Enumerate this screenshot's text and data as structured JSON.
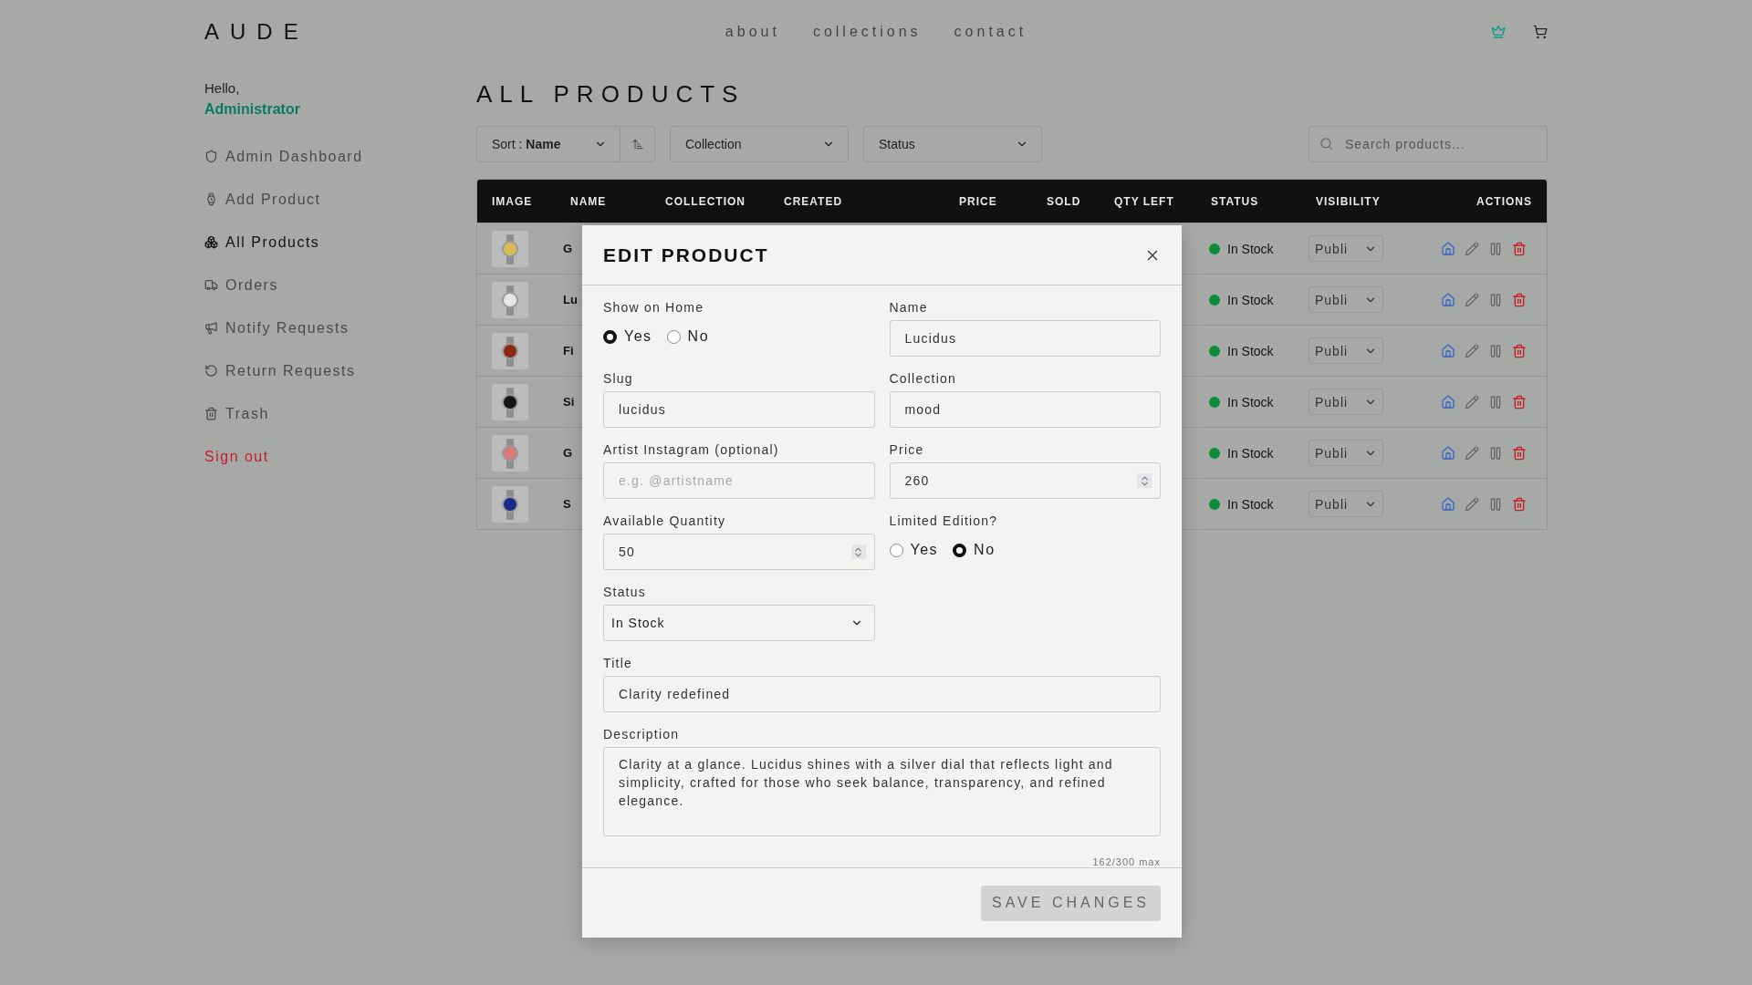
{
  "header": {
    "logo": "AUDE",
    "nav": [
      {
        "label": "about"
      },
      {
        "label": "collections"
      },
      {
        "label": "contact"
      }
    ]
  },
  "sidebar": {
    "greeting": "Hello,",
    "user": "Administrator",
    "items": [
      {
        "label": "Admin Dashboard",
        "selected": false
      },
      {
        "label": "Add Product",
        "selected": false
      },
      {
        "label": "All Products",
        "selected": true
      },
      {
        "label": "Orders",
        "selected": false
      },
      {
        "label": "Notify Requests",
        "selected": false
      },
      {
        "label": "Return Requests",
        "selected": false
      },
      {
        "label": "Trash",
        "selected": false
      }
    ],
    "sign_out": "Sign out"
  },
  "page_title": "ALL PRODUCTS",
  "toolbar": {
    "sort_label": "Sort :",
    "sort_value": "Name",
    "collection": "Collection",
    "status": "Status",
    "search": {
      "placeholder": "Search products..."
    }
  },
  "table": {
    "columns": [
      "IMAGE",
      "NAME",
      "COLLECTION",
      "CREATED",
      "PRICE",
      "SOLD",
      "QTY LEFT",
      "STATUS",
      "VISIBILITY",
      "ACTIONS"
    ],
    "rows": [
      {
        "name": "G",
        "status": "In Stock",
        "color": "#0f8a3a",
        "visibility": "Publi"
      },
      {
        "name": "Lu",
        "status": "In Stock",
        "color": "#0f8a3a",
        "visibility": "Publi"
      },
      {
        "name": "Fi",
        "status": "In Stock",
        "color": "#0f8a3a",
        "visibility": "Publi"
      },
      {
        "name": "Si",
        "status": "In Stock",
        "color": "#0f8a3a",
        "visibility": "Publi"
      },
      {
        "name": "G",
        "status": "In Stock",
        "color": "#0f8a3a",
        "visibility": "Publi"
      },
      {
        "name": "S",
        "status": "In Stock",
        "color": "#0f8a3a",
        "visibility": "Publi"
      }
    ]
  },
  "modal": {
    "title": "EDIT PRODUCT",
    "fields": [
      {
        "kind": "radio",
        "label": "Show on Home",
        "options": [
          {
            "label": "Yes",
            "selected": true
          },
          {
            "label": "No",
            "selected": false
          }
        ]
      },
      {
        "kind": "text",
        "label": "Name",
        "value": "Lucidus"
      },
      {
        "kind": "text",
        "label": "Slug",
        "value": "lucidus"
      },
      {
        "kind": "text",
        "label": "Collection",
        "value": "mood"
      },
      {
        "kind": "text",
        "label": "Artist Instagram (optional)",
        "placeholder": "e.g. @artistname"
      },
      {
        "kind": "number",
        "label": "Price",
        "value": "260"
      },
      {
        "kind": "number",
        "label": "Available Quantity",
        "value": "50"
      },
      {
        "kind": "radio",
        "label": "Limited Edition?",
        "options": [
          {
            "label": "Yes",
            "selected": false
          },
          {
            "label": "No",
            "selected": true
          }
        ]
      },
      {
        "kind": "select",
        "label": "Status",
        "value": "In Stock"
      }
    ],
    "title_field": {
      "label": "Title",
      "value": "Clarity redefined"
    },
    "description_field": {
      "label": "Description",
      "value": "Clarity at a glance. Lucidus shines with a silver dial that reflects light and simplicity, crafted for those who seek balance, transparency, and refined elegance.",
      "counter": "162/300 max"
    },
    "save_button": "SAVE CHANGES"
  }
}
